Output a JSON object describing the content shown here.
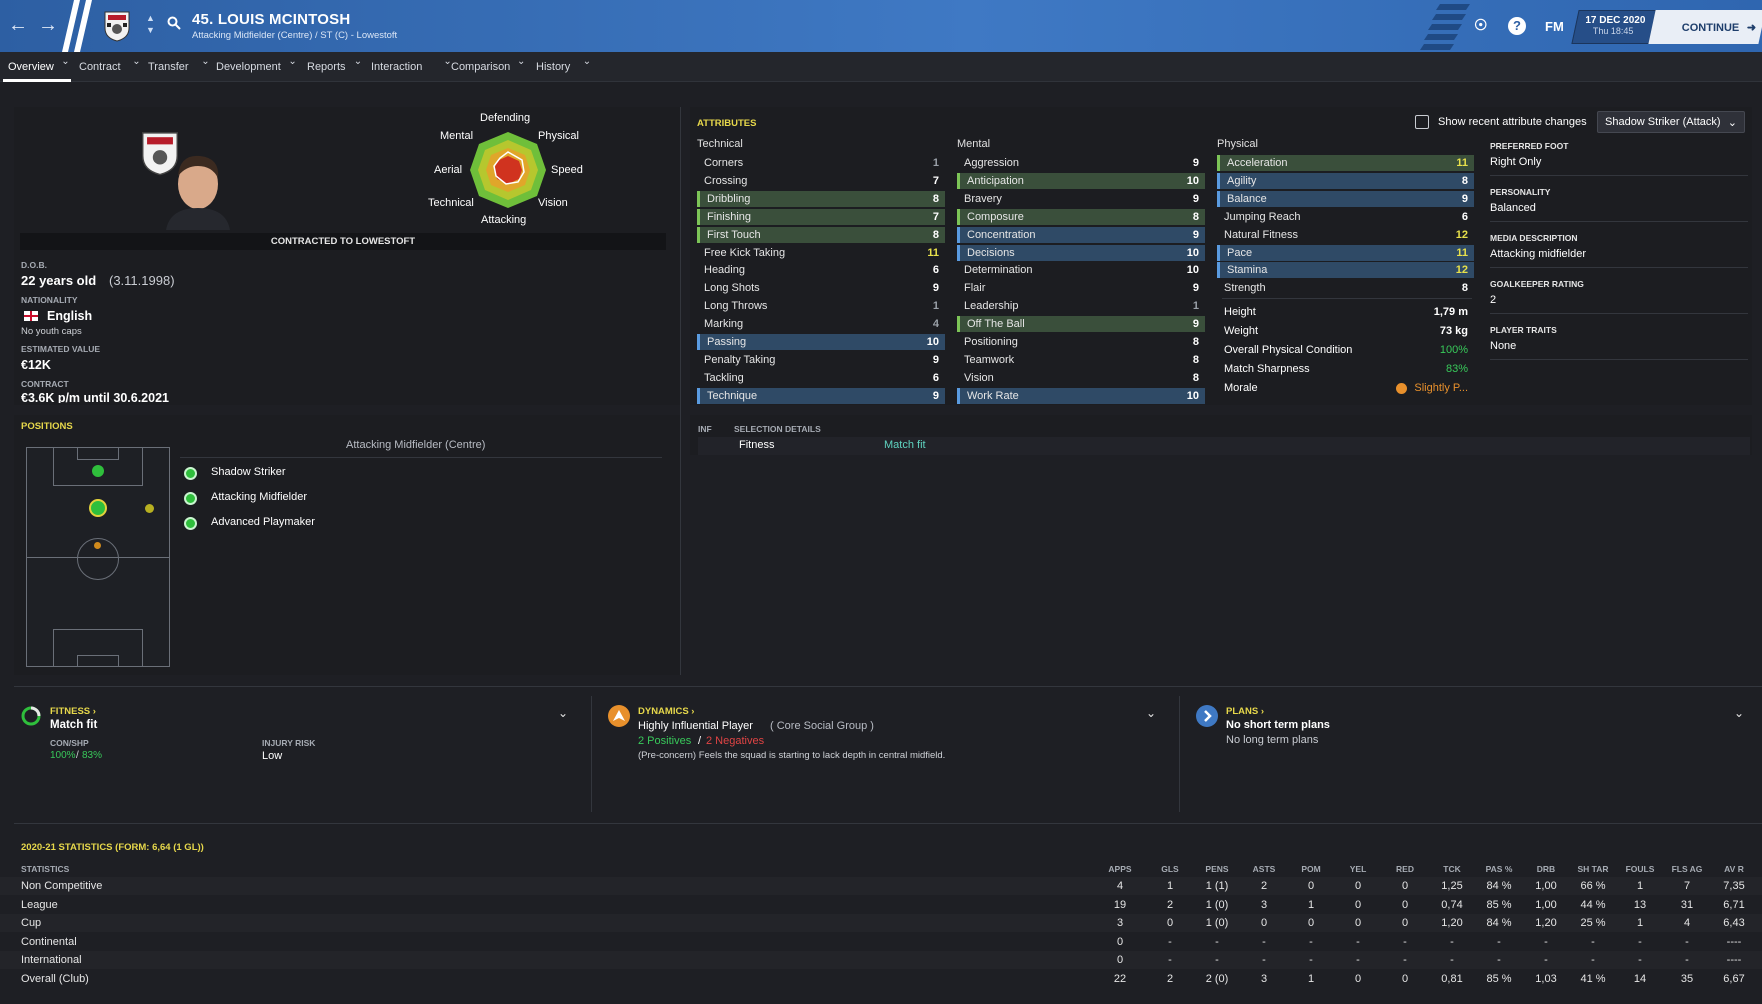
{
  "header": {
    "player_name": "45. LOUIS MCINTOSH",
    "player_sub": "Attacking Midfielder (Centre) / ST (C) - Lowestoft",
    "date": "17 DEC 2020",
    "time": "Thu 18:45",
    "continue_label": "CONTINUE",
    "fm_label": "FM",
    "help_label": "?"
  },
  "tabs": [
    "Overview",
    "Contract",
    "Transfer",
    "Development",
    "Reports",
    "Interaction",
    "Comparison",
    "History"
  ],
  "profile": {
    "radar_labels": {
      "top": "Defending",
      "tl": "Mental",
      "tr": "Physical",
      "l": "Aerial",
      "r": "Speed",
      "bl": "Technical",
      "br": "Vision",
      "bottom": "Attacking"
    },
    "contract_banner": "CONTRACTED TO LOWESTOFT",
    "dob_label": "D.O.B.",
    "age": "22 years old",
    "dob": "(3.11.1998)",
    "nationality_label": "NATIONALITY",
    "nationality": "English",
    "youth_caps": "No youth caps",
    "value_label": "ESTIMATED VALUE",
    "value": "€12K",
    "contract_label": "CONTRACT",
    "contract": "€3.6K p/m until 30.6.2021"
  },
  "attributes": {
    "heading": "ATTRIBUTES",
    "show_changes": "Show recent attribute changes",
    "role_select": "Shadow Striker (Attack)",
    "technical_label": "Technical",
    "mental_label": "Mental",
    "physical_label": "Physical",
    "technical": [
      [
        "Corners",
        "1",
        ""
      ],
      [
        "Crossing",
        "7",
        ""
      ],
      [
        "Dribbling",
        "8",
        "g"
      ],
      [
        "Finishing",
        "7",
        "g"
      ],
      [
        "First Touch",
        "8",
        "g"
      ],
      [
        "Free Kick Taking",
        "11",
        ""
      ],
      [
        "Heading",
        "6",
        ""
      ],
      [
        "Long Shots",
        "9",
        ""
      ],
      [
        "Long Throws",
        "1",
        ""
      ],
      [
        "Marking",
        "4",
        ""
      ],
      [
        "Passing",
        "10",
        "b"
      ],
      [
        "Penalty Taking",
        "9",
        ""
      ],
      [
        "Tackling",
        "6",
        ""
      ],
      [
        "Technique",
        "9",
        "b"
      ]
    ],
    "mental": [
      [
        "Aggression",
        "9",
        ""
      ],
      [
        "Anticipation",
        "10",
        "g"
      ],
      [
        "Bravery",
        "9",
        ""
      ],
      [
        "Composure",
        "8",
        "g"
      ],
      [
        "Concentration",
        "9",
        "b"
      ],
      [
        "Decisions",
        "10",
        "b"
      ],
      [
        "Determination",
        "10",
        ""
      ],
      [
        "Flair",
        "9",
        ""
      ],
      [
        "Leadership",
        "1",
        ""
      ],
      [
        "Off The Ball",
        "9",
        "g"
      ],
      [
        "Positioning",
        "8",
        ""
      ],
      [
        "Teamwork",
        "8",
        ""
      ],
      [
        "Vision",
        "8",
        ""
      ],
      [
        "Work Rate",
        "10",
        "b"
      ]
    ],
    "physical": [
      [
        "Acceleration",
        "11",
        "g"
      ],
      [
        "Agility",
        "8",
        "b"
      ],
      [
        "Balance",
        "9",
        "b"
      ],
      [
        "Jumping Reach",
        "6",
        ""
      ],
      [
        "Natural Fitness",
        "12",
        ""
      ],
      [
        "Pace",
        "11",
        "b"
      ],
      [
        "Stamina",
        "12",
        "b"
      ],
      [
        "Strength",
        "8",
        ""
      ]
    ],
    "extra": [
      [
        "Height",
        "1,79 m"
      ],
      [
        "Weight",
        "73 kg"
      ],
      [
        "Overall Physical Condition",
        "100%"
      ],
      [
        "Match Sharpness",
        "83%"
      ],
      [
        "Morale",
        "Slightly P..."
      ]
    ],
    "side": [
      [
        "PREFERRED FOOT",
        "Right Only"
      ],
      [
        "PERSONALITY",
        "Balanced"
      ],
      [
        "MEDIA DESCRIPTION",
        "Attacking midfielder"
      ],
      [
        "GOALKEEPER RATING",
        "2"
      ],
      [
        "PLAYER TRAITS",
        "None"
      ]
    ]
  },
  "positions": {
    "heading": "POSITIONS",
    "main": "Attacking Midfielder (Centre)",
    "roles": [
      "Shadow Striker",
      "Attacking Midfielder",
      "Advanced Playmaker"
    ]
  },
  "selection": {
    "inf": "INF",
    "heading": "SELECTION DETAILS",
    "fitness_label": "Fitness",
    "fitness_value": "Match fit"
  },
  "fitness": {
    "heading": "FITNESS",
    "status": "Match fit",
    "conshp_label": "CON/SHP",
    "con": "100%",
    "shp": "83%",
    "injury_label": "INJURY RISK",
    "injury": "Low"
  },
  "dynamics": {
    "heading": "DYNAMICS",
    "influence": "Highly Influential Player",
    "group": "( Core Social Group )",
    "positives": "2 Positives",
    "negatives": "2 Negatives",
    "note": "(Pre-concern) Feels the squad is starting to lack depth in central midfield."
  },
  "plans": {
    "heading": "PLANS",
    "short": "No short term plans",
    "long": "No long term plans"
  },
  "stats": {
    "heading": "2020-21 STATISTICS (FORM: 6,64 (1 GL))",
    "label": "STATISTICS",
    "columns": [
      "APPS",
      "GLS",
      "PENS",
      "ASTS",
      "POM",
      "YEL",
      "RED",
      "TCK",
      "PAS %",
      "DRB",
      "SH TAR",
      "FOULS",
      "FLS AG",
      "AV R"
    ],
    "rows": [
      [
        "Non Competitive",
        "4",
        "1",
        "1 (1)",
        "2",
        "0",
        "0",
        "0",
        "1,25",
        "84 %",
        "1,00",
        "66 %",
        "1",
        "7",
        "7,35"
      ],
      [
        "League",
        "19",
        "2",
        "1 (0)",
        "3",
        "1",
        "0",
        "0",
        "0,74",
        "85 %",
        "1,00",
        "44 %",
        "13",
        "31",
        "6,71"
      ],
      [
        "Cup",
        "3",
        "0",
        "1 (0)",
        "0",
        "0",
        "0",
        "0",
        "1,20",
        "84 %",
        "1,20",
        "25 %",
        "1",
        "4",
        "6,43"
      ],
      [
        "Continental",
        "0",
        "-",
        "-",
        "-",
        "-",
        "-",
        "-",
        "-",
        "-",
        "-",
        "-",
        "-",
        "-",
        "----"
      ],
      [
        "International",
        "0",
        "-",
        "-",
        "-",
        "-",
        "-",
        "-",
        "-",
        "-",
        "-",
        "-",
        "-",
        "-",
        "----"
      ],
      [
        "Overall (Club)",
        "22",
        "2",
        "2 (0)",
        "3",
        "1",
        "0",
        "0",
        "0,81",
        "85 %",
        "1,03",
        "41 %",
        "14",
        "35",
        "6,67"
      ]
    ]
  },
  "colors": {
    "accent_yellow": "#e7d84b",
    "blue_bar": "#2d5fa3",
    "positive": "#38c95a",
    "negative": "#e04444"
  }
}
